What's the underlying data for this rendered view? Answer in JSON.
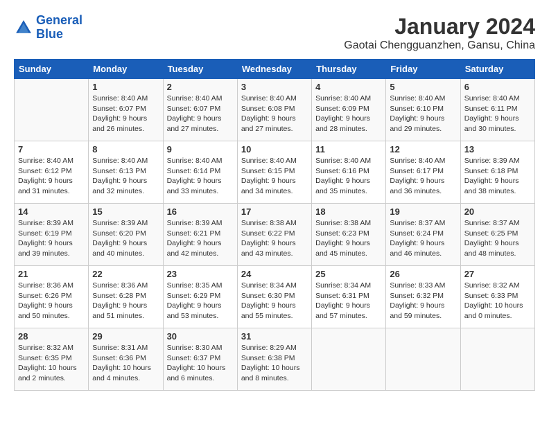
{
  "logo": {
    "line1": "General",
    "line2": "Blue"
  },
  "title": "January 2024",
  "subtitle": "Gaotai Chengguanzhen, Gansu, China",
  "headers": [
    "Sunday",
    "Monday",
    "Tuesday",
    "Wednesday",
    "Thursday",
    "Friday",
    "Saturday"
  ],
  "weeks": [
    [
      {
        "day": "",
        "sunrise": "",
        "sunset": "",
        "daylight": ""
      },
      {
        "day": "1",
        "sunrise": "Sunrise: 8:40 AM",
        "sunset": "Sunset: 6:07 PM",
        "daylight": "Daylight: 9 hours and 26 minutes."
      },
      {
        "day": "2",
        "sunrise": "Sunrise: 8:40 AM",
        "sunset": "Sunset: 6:07 PM",
        "daylight": "Daylight: 9 hours and 27 minutes."
      },
      {
        "day": "3",
        "sunrise": "Sunrise: 8:40 AM",
        "sunset": "Sunset: 6:08 PM",
        "daylight": "Daylight: 9 hours and 27 minutes."
      },
      {
        "day": "4",
        "sunrise": "Sunrise: 8:40 AM",
        "sunset": "Sunset: 6:09 PM",
        "daylight": "Daylight: 9 hours and 28 minutes."
      },
      {
        "day": "5",
        "sunrise": "Sunrise: 8:40 AM",
        "sunset": "Sunset: 6:10 PM",
        "daylight": "Daylight: 9 hours and 29 minutes."
      },
      {
        "day": "6",
        "sunrise": "Sunrise: 8:40 AM",
        "sunset": "Sunset: 6:11 PM",
        "daylight": "Daylight: 9 hours and 30 minutes."
      }
    ],
    [
      {
        "day": "7",
        "sunrise": "Sunrise: 8:40 AM",
        "sunset": "Sunset: 6:12 PM",
        "daylight": "Daylight: 9 hours and 31 minutes."
      },
      {
        "day": "8",
        "sunrise": "Sunrise: 8:40 AM",
        "sunset": "Sunset: 6:13 PM",
        "daylight": "Daylight: 9 hours and 32 minutes."
      },
      {
        "day": "9",
        "sunrise": "Sunrise: 8:40 AM",
        "sunset": "Sunset: 6:14 PM",
        "daylight": "Daylight: 9 hours and 33 minutes."
      },
      {
        "day": "10",
        "sunrise": "Sunrise: 8:40 AM",
        "sunset": "Sunset: 6:15 PM",
        "daylight": "Daylight: 9 hours and 34 minutes."
      },
      {
        "day": "11",
        "sunrise": "Sunrise: 8:40 AM",
        "sunset": "Sunset: 6:16 PM",
        "daylight": "Daylight: 9 hours and 35 minutes."
      },
      {
        "day": "12",
        "sunrise": "Sunrise: 8:40 AM",
        "sunset": "Sunset: 6:17 PM",
        "daylight": "Daylight: 9 hours and 36 minutes."
      },
      {
        "day": "13",
        "sunrise": "Sunrise: 8:39 AM",
        "sunset": "Sunset: 6:18 PM",
        "daylight": "Daylight: 9 hours and 38 minutes."
      }
    ],
    [
      {
        "day": "14",
        "sunrise": "Sunrise: 8:39 AM",
        "sunset": "Sunset: 6:19 PM",
        "daylight": "Daylight: 9 hours and 39 minutes."
      },
      {
        "day": "15",
        "sunrise": "Sunrise: 8:39 AM",
        "sunset": "Sunset: 6:20 PM",
        "daylight": "Daylight: 9 hours and 40 minutes."
      },
      {
        "day": "16",
        "sunrise": "Sunrise: 8:39 AM",
        "sunset": "Sunset: 6:21 PM",
        "daylight": "Daylight: 9 hours and 42 minutes."
      },
      {
        "day": "17",
        "sunrise": "Sunrise: 8:38 AM",
        "sunset": "Sunset: 6:22 PM",
        "daylight": "Daylight: 9 hours and 43 minutes."
      },
      {
        "day": "18",
        "sunrise": "Sunrise: 8:38 AM",
        "sunset": "Sunset: 6:23 PM",
        "daylight": "Daylight: 9 hours and 45 minutes."
      },
      {
        "day": "19",
        "sunrise": "Sunrise: 8:37 AM",
        "sunset": "Sunset: 6:24 PM",
        "daylight": "Daylight: 9 hours and 46 minutes."
      },
      {
        "day": "20",
        "sunrise": "Sunrise: 8:37 AM",
        "sunset": "Sunset: 6:25 PM",
        "daylight": "Daylight: 9 hours and 48 minutes."
      }
    ],
    [
      {
        "day": "21",
        "sunrise": "Sunrise: 8:36 AM",
        "sunset": "Sunset: 6:26 PM",
        "daylight": "Daylight: 9 hours and 50 minutes."
      },
      {
        "day": "22",
        "sunrise": "Sunrise: 8:36 AM",
        "sunset": "Sunset: 6:28 PM",
        "daylight": "Daylight: 9 hours and 51 minutes."
      },
      {
        "day": "23",
        "sunrise": "Sunrise: 8:35 AM",
        "sunset": "Sunset: 6:29 PM",
        "daylight": "Daylight: 9 hours and 53 minutes."
      },
      {
        "day": "24",
        "sunrise": "Sunrise: 8:34 AM",
        "sunset": "Sunset: 6:30 PM",
        "daylight": "Daylight: 9 hours and 55 minutes."
      },
      {
        "day": "25",
        "sunrise": "Sunrise: 8:34 AM",
        "sunset": "Sunset: 6:31 PM",
        "daylight": "Daylight: 9 hours and 57 minutes."
      },
      {
        "day": "26",
        "sunrise": "Sunrise: 8:33 AM",
        "sunset": "Sunset: 6:32 PM",
        "daylight": "Daylight: 9 hours and 59 minutes."
      },
      {
        "day": "27",
        "sunrise": "Sunrise: 8:32 AM",
        "sunset": "Sunset: 6:33 PM",
        "daylight": "Daylight: 10 hours and 0 minutes."
      }
    ],
    [
      {
        "day": "28",
        "sunrise": "Sunrise: 8:32 AM",
        "sunset": "Sunset: 6:35 PM",
        "daylight": "Daylight: 10 hours and 2 minutes."
      },
      {
        "day": "29",
        "sunrise": "Sunrise: 8:31 AM",
        "sunset": "Sunset: 6:36 PM",
        "daylight": "Daylight: 10 hours and 4 minutes."
      },
      {
        "day": "30",
        "sunrise": "Sunrise: 8:30 AM",
        "sunset": "Sunset: 6:37 PM",
        "daylight": "Daylight: 10 hours and 6 minutes."
      },
      {
        "day": "31",
        "sunrise": "Sunrise: 8:29 AM",
        "sunset": "Sunset: 6:38 PM",
        "daylight": "Daylight: 10 hours and 8 minutes."
      },
      {
        "day": "",
        "sunrise": "",
        "sunset": "",
        "daylight": ""
      },
      {
        "day": "",
        "sunrise": "",
        "sunset": "",
        "daylight": ""
      },
      {
        "day": "",
        "sunrise": "",
        "sunset": "",
        "daylight": ""
      }
    ]
  ]
}
